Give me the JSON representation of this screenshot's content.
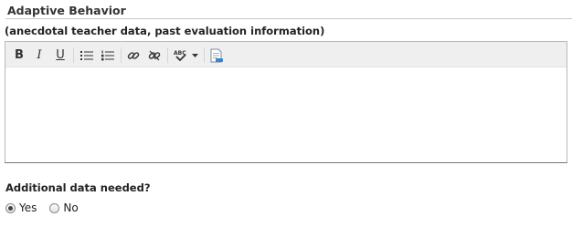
{
  "section": {
    "title": "Adaptive Behavior",
    "subtitle": "(anecdotal teacher data, past evaluation information)"
  },
  "editor": {
    "content": "",
    "toolbar": {
      "bold": "B",
      "italic": "I",
      "underline": "U",
      "icons": [
        "bullet-list-icon",
        "numbered-list-icon",
        "link-icon",
        "unlink-icon",
        "spellcheck-icon",
        "dropdown-arrow-icon",
        "insert-document-icon"
      ]
    }
  },
  "additional": {
    "question": "Additional data needed?",
    "options": [
      {
        "label": "Yes",
        "selected": true
      },
      {
        "label": "No",
        "selected": false
      }
    ]
  }
}
